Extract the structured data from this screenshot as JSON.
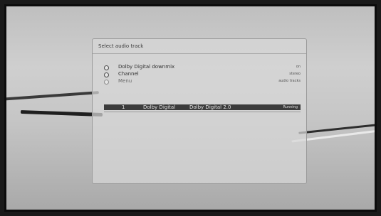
{
  "dialog": {
    "title": "Select audio track",
    "options": [
      {
        "label": "Dolby Digital downmix",
        "value": "on",
        "enabled": true
      },
      {
        "label": "Channel",
        "value": "stereo",
        "enabled": true
      },
      {
        "label": "Menu",
        "value": "audio tracks",
        "enabled": false
      }
    ],
    "track": {
      "number": "1",
      "codec": "Dolby Digital",
      "format": "Dolby Digital 2.0",
      "status": "Running"
    }
  }
}
